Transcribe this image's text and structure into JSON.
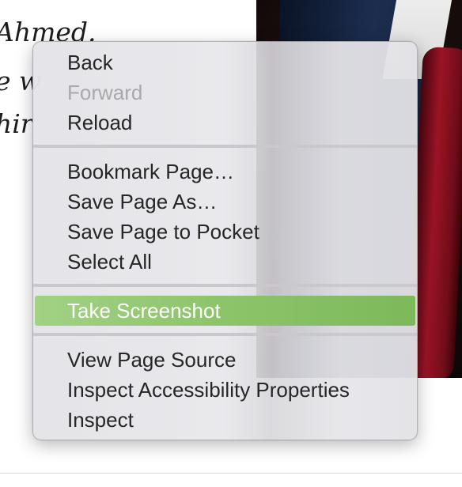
{
  "background": {
    "text_lines": [
      "Ahmed.",
      "e w",
      "hir"
    ]
  },
  "menu": {
    "items": [
      {
        "label": "Back",
        "enabled": true
      },
      {
        "label": "Forward",
        "enabled": false
      },
      {
        "label": "Reload",
        "enabled": true
      },
      {
        "label": "Bookmark Page…",
        "enabled": true
      },
      {
        "label": "Save Page As…",
        "enabled": true
      },
      {
        "label": "Save Page to Pocket",
        "enabled": true
      },
      {
        "label": "Select All",
        "enabled": true
      },
      {
        "label": "Take Screenshot",
        "enabled": true,
        "highlighted": true
      },
      {
        "label": "View Page Source",
        "enabled": true
      },
      {
        "label": "Inspect Accessibility Properties",
        "enabled": true
      },
      {
        "label": "Inspect",
        "enabled": true
      }
    ],
    "highlight_color": "#8cc46a"
  }
}
